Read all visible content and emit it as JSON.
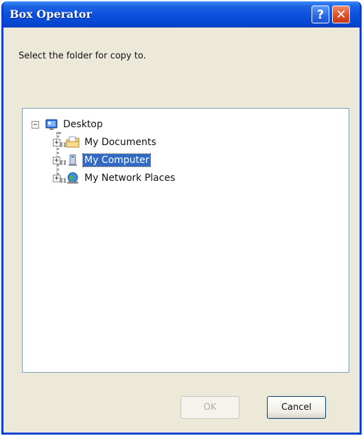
{
  "window": {
    "title": "Box Operator",
    "help_glyph": "?",
    "close_glyph": "✕"
  },
  "prompt": "Select the folder for copy to.",
  "tree": {
    "root": {
      "label": "Desktop",
      "expander": "−"
    },
    "children": [
      {
        "label": "My Documents",
        "expander": "+",
        "icon": "folder-documents-icon"
      },
      {
        "label": "My Computer",
        "expander": "+",
        "icon": "computer-icon",
        "selected": true
      },
      {
        "label": "My Network Places",
        "expander": "+",
        "icon": "network-icon"
      }
    ]
  },
  "buttons": {
    "ok_label": "OK",
    "cancel_label": "Cancel"
  },
  "colors": {
    "title_bar": "#0a4fdc",
    "selection": "#316ac5",
    "dialog_bg": "#ece9d8"
  }
}
